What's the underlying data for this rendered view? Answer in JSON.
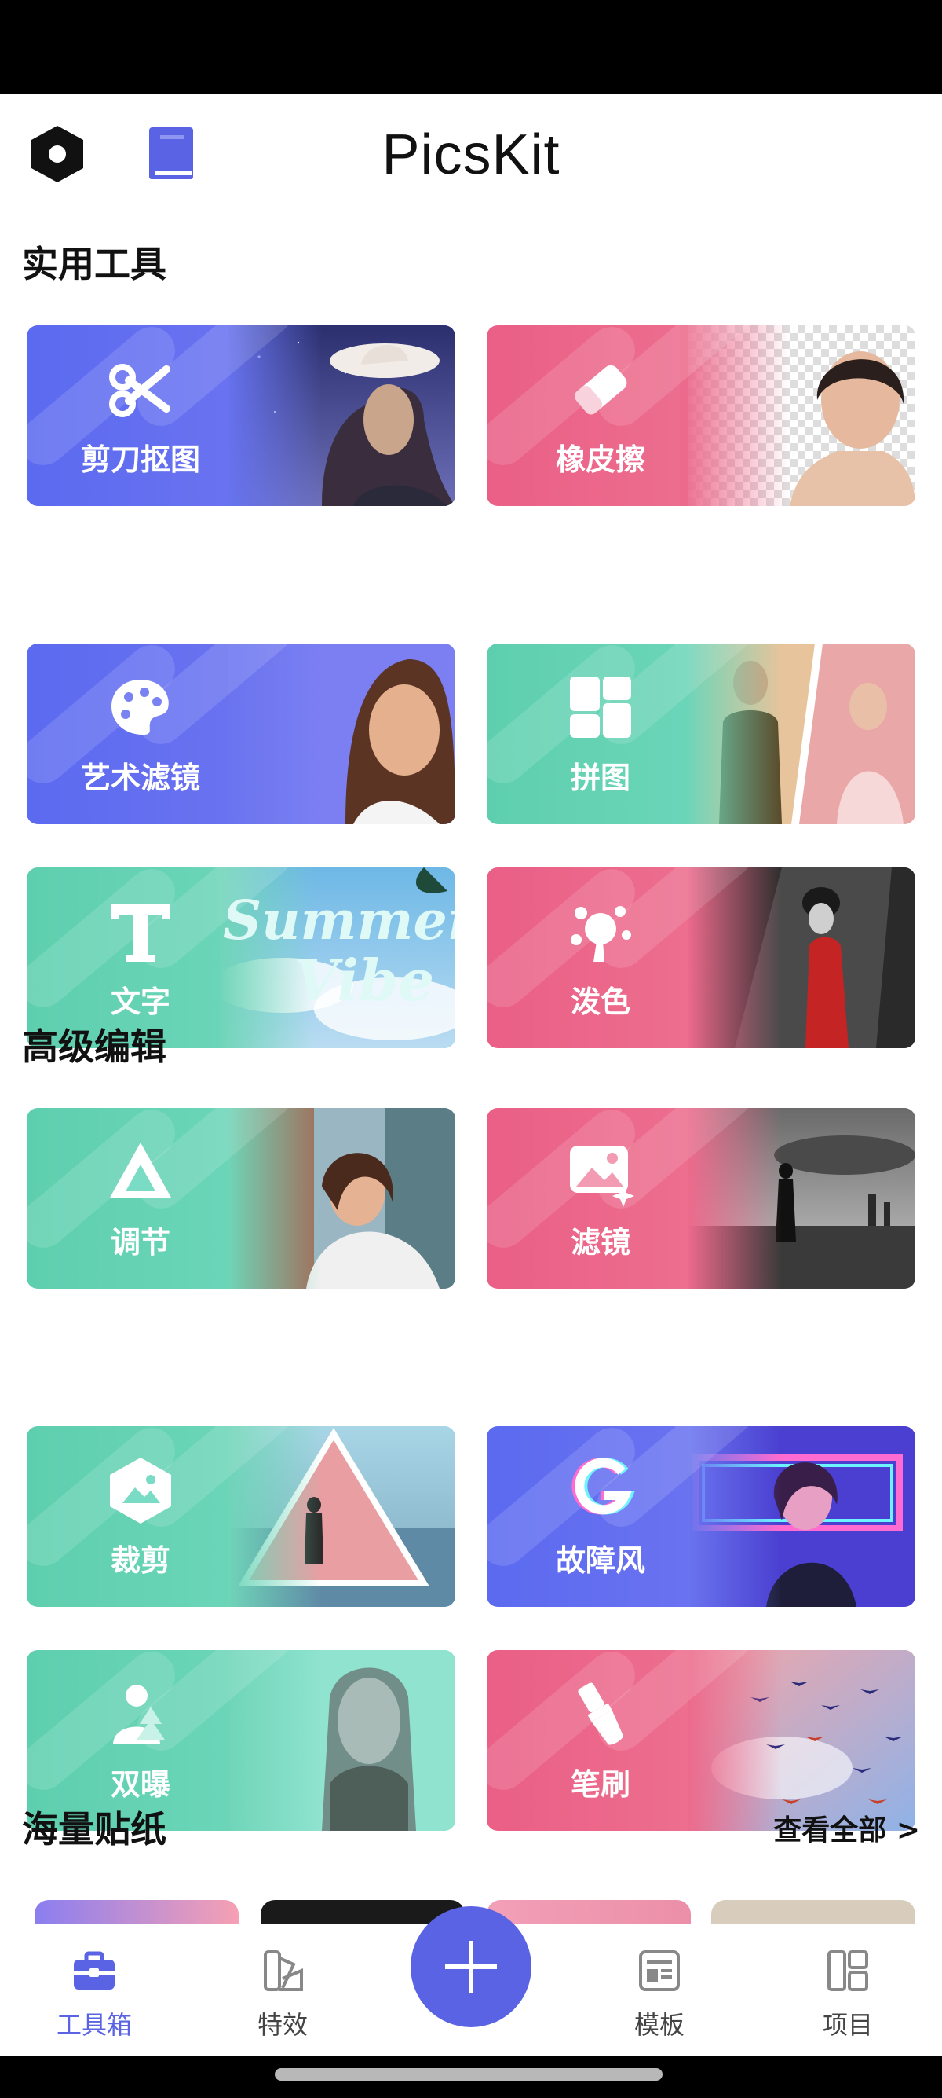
{
  "app": {
    "title": "PicsKit"
  },
  "header": {
    "settings_icon": "hexagon-settings-icon",
    "guide_icon": "book-icon"
  },
  "sections": {
    "practical": {
      "title": "实用工具"
    },
    "advanced": {
      "title": "高级编辑"
    },
    "stickers": {
      "title": "海量贴纸",
      "see_all": "查看全部 >"
    }
  },
  "tools": {
    "cutout": {
      "label": "剪刀抠图",
      "icon": "scissors-icon"
    },
    "eraser": {
      "label": "橡皮擦",
      "icon": "eraser-icon"
    },
    "art_filter": {
      "label": "艺术滤镜",
      "icon": "palette-icon"
    },
    "collage": {
      "label": "拼图",
      "icon": "collage-icon"
    },
    "text": {
      "label": "文字",
      "icon": "text-icon",
      "art_text_line1": "Summer",
      "art_text_line2": "Vibe"
    },
    "splash": {
      "label": "泼色",
      "icon": "splash-icon"
    },
    "adjust": {
      "label": "调节",
      "icon": "adjust-icon"
    },
    "filter": {
      "label": "滤镜",
      "icon": "filter-icon"
    },
    "crop": {
      "label": "裁剪",
      "icon": "crop-icon"
    },
    "glitch": {
      "label": "故障风",
      "icon": "glitch-icon"
    },
    "double_exposure": {
      "label": "双曝",
      "icon": "double-exposure-icon"
    },
    "brush": {
      "label": "笔刷",
      "icon": "brush-icon"
    }
  },
  "colors": {
    "blue": "#5b6af0",
    "pink": "#ea5f86",
    "teal": "#5ecfae",
    "accent": "#5a63e4"
  },
  "tabbar": {
    "toolbox": "工具箱",
    "effects": "特效",
    "templates": "模板",
    "projects": "项目",
    "add_icon": "plus-icon"
  }
}
